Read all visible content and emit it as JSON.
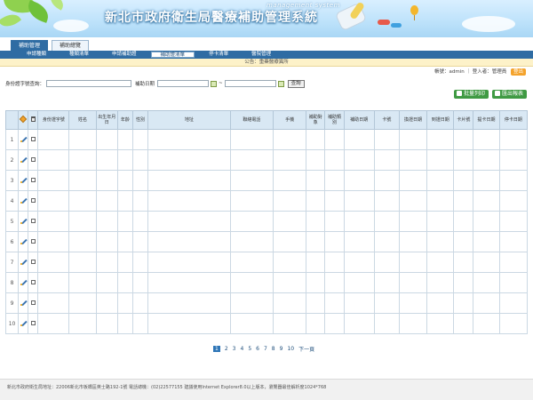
{
  "header": {
    "title": "新北市政府衛生局醫療補助管理系統",
    "subtitle": "management system"
  },
  "tabs": [
    {
      "label": "補助管理",
      "active": true
    },
    {
      "label": "補助總覽",
      "active": false
    }
  ],
  "nav": [
    {
      "label": "申請種類",
      "active": false
    },
    {
      "label": "種類清單",
      "active": false
    },
    {
      "label": "申請補助證",
      "active": false
    },
    {
      "label": "補助證清單",
      "active": true
    },
    {
      "label": "停卡清單",
      "active": false
    },
    {
      "label": "醫院管理",
      "active": false
    }
  ],
  "notice": "公告：重藥醫療異所",
  "userbar": {
    "text": "帳號：admin ｜ 登入者：管理員",
    "logout": "登出"
  },
  "search": {
    "id_label": "身份證字號查詢：",
    "date_label": "補助日期",
    "range_sep": "~",
    "button": "查詢"
  },
  "actions": {
    "print": "批量列印",
    "export": "匯出報表"
  },
  "table": {
    "columns": [
      "身份證字號",
      "姓名",
      "出生年月日",
      "年齡",
      "性別",
      "地址",
      "聯絡電話",
      "手機",
      "補助對象",
      "補助類別",
      "補助日期",
      "卡號",
      "換證日期",
      "到證日期",
      "卡片號",
      "提卡日期",
      "停卡日期"
    ],
    "rows": [
      "1",
      "2",
      "3",
      "4",
      "5",
      "6",
      "7",
      "8",
      "9",
      "10"
    ]
  },
  "pager": {
    "pages": [
      "1",
      "2",
      "3",
      "4",
      "5",
      "6",
      "7",
      "8",
      "9",
      "10"
    ],
    "next": "下一頁",
    "current": "1"
  },
  "footer": "新北市政府衛生局地址：22006新北市板橋區英士路192-1號 電話總機：(02)22577155 建議使用Internet Explorer8.0以上版本，瀏覽器最佳解析度1024*768"
}
